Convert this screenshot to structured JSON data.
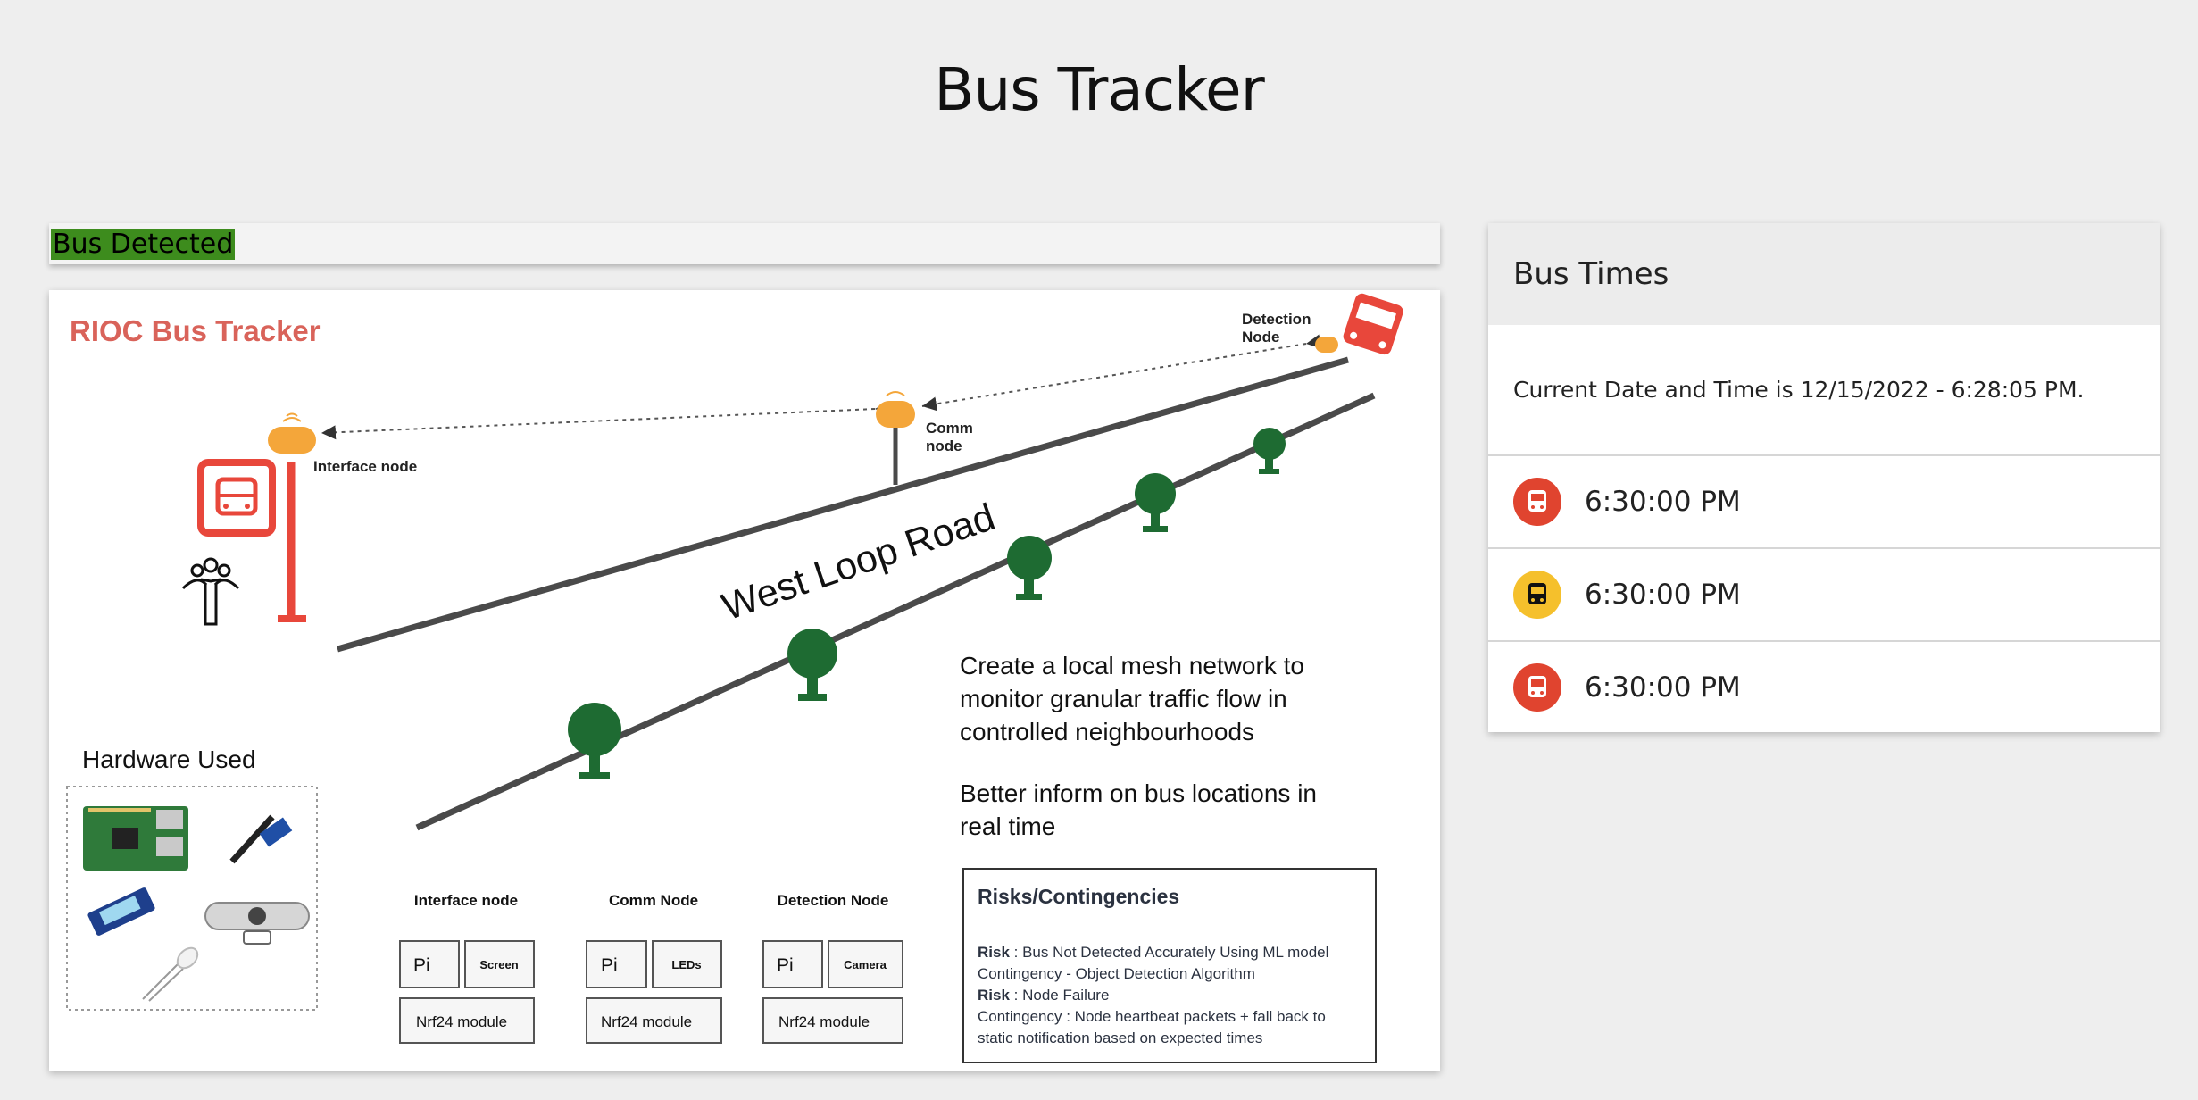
{
  "page": {
    "title": "Bus Tracker"
  },
  "status": {
    "badge": "Bus Detected",
    "color": "#3d8c1d"
  },
  "diagram": {
    "title": "RIOC Bus Tracker",
    "road_label": "West Loop Road",
    "nodes": {
      "interface": "Interface node",
      "comm_line1": "Comm",
      "comm_line2": "node",
      "detection_line1": "Detection",
      "detection_line2": "Node"
    },
    "description": {
      "p1": [
        "Create a local mesh network to",
        "monitor granular traffic flow in",
        "controlled neighbourhoods"
      ],
      "p2": [
        "Better inform on bus locations in",
        "real time"
      ]
    },
    "hardware_title": "Hardware Used",
    "node_boxes": [
      {
        "title": "Interface node",
        "part_a": "Pi",
        "part_b": "Screen",
        "module": "Nrf24 module"
      },
      {
        "title": "Comm Node",
        "part_a": "Pi",
        "part_b": "LEDs",
        "module": "Nrf24 module"
      },
      {
        "title": "Detection Node",
        "part_a": "Pi",
        "part_b": "Camera",
        "module": "Nrf24 module"
      }
    ],
    "risks": {
      "title": "Risks/Contingencies",
      "risk_label": "Risk",
      "risk1": " : Bus Not Detected Accurately Using ML model",
      "cont1": "Contingency - Object Detection Algorithm",
      "risk2": " : Node Failure",
      "cont2a": "Contingency : Node heartbeat packets + fall back to",
      "cont2b": "static notification based on expected times"
    },
    "colors": {
      "red": "#e8473b",
      "tree": "#1e6b32",
      "road": "#4a4a4a",
      "node": "#f4a63a"
    }
  },
  "bus_times": {
    "title": "Bus Times",
    "current": "Current Date and Time is 12/15/2022 - 6:28:05 PM.",
    "rows": [
      {
        "time": "6:30:00 PM",
        "icon": "bus-icon",
        "color": "#e0442f"
      },
      {
        "time": "6:30:00 PM",
        "icon": "bus-icon",
        "color": "#f5c02c"
      },
      {
        "time": "6:30:00 PM",
        "icon": "bus-icon",
        "color": "#e0442f"
      }
    ]
  }
}
